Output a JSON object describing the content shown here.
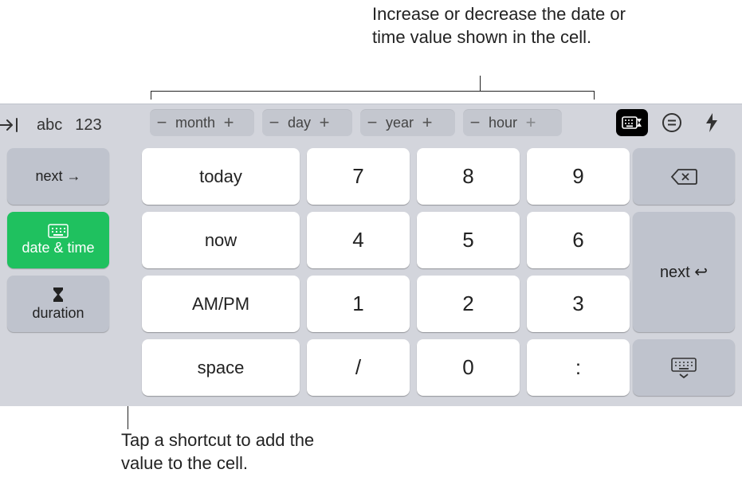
{
  "annotations": {
    "top": "Increase or decrease the date or time value shown in the cell.",
    "bottom": "Tap a shortcut to add the value to the cell."
  },
  "header": {
    "mode_abc": "abc",
    "mode_123": "123"
  },
  "steppers": {
    "minus": "−",
    "plus": "+",
    "month": "month",
    "day": "day",
    "year": "year",
    "hour": "hour"
  },
  "left": {
    "next": "next →",
    "datetime": "date & time",
    "duration": "duration"
  },
  "shortcuts": {
    "today": "today",
    "now": "now",
    "ampm": "AM/PM",
    "space": "space"
  },
  "keys": {
    "k7": "7",
    "k8": "8",
    "k9": "9",
    "k4": "4",
    "k5": "5",
    "k6": "6",
    "k1": "1",
    "k2": "2",
    "k3": "3",
    "slash": "/",
    "k0": "0",
    "colon": ":"
  },
  "right": {
    "next": "next ↩"
  },
  "icons": {
    "tab_arrow": "tab-right-icon",
    "keypad": "keyboard-datetime-icon",
    "equals": "formula-equals-icon",
    "bolt": "quick-actions-icon",
    "calendar": "calendar-keyboard-icon",
    "hourglass": "hourglass-icon",
    "backspace": "backspace-icon",
    "dismiss": "dismiss-keyboard-icon"
  }
}
